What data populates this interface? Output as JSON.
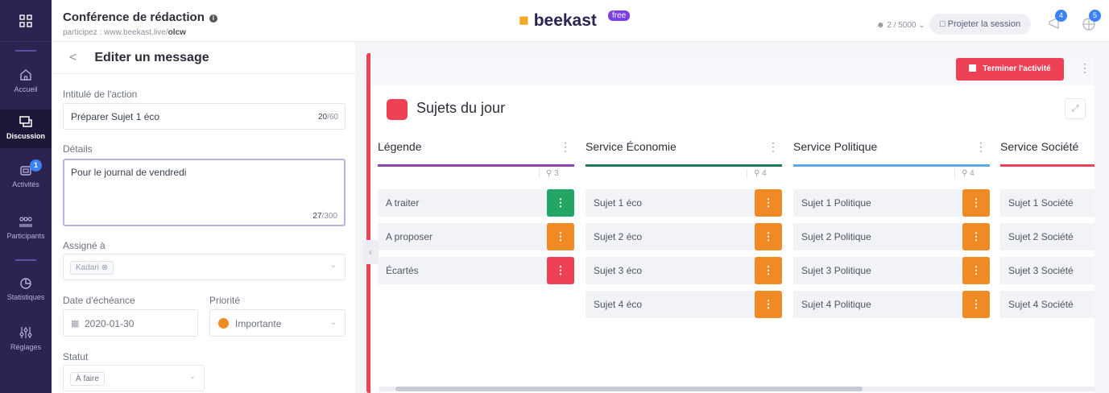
{
  "sidebar": {
    "items": [
      {
        "label": "Accueil",
        "icon": "home-icon"
      },
      {
        "label": "Discussion",
        "icon": "chat-icon",
        "active": true
      },
      {
        "label": "Activités",
        "icon": "activities-icon",
        "badge": "1"
      },
      {
        "label": "Participants",
        "icon": "participants-icon"
      },
      {
        "label": "Statistiques",
        "icon": "stats-icon"
      },
      {
        "label": "Réglages",
        "icon": "settings-icon"
      }
    ]
  },
  "header": {
    "title": "Conférence de rédaction",
    "info": "i",
    "subtitle_prefix": "participez : www.beekast.live/",
    "subtitle_code": "olcw",
    "brand": "beekast",
    "brand_badge": "free",
    "participants": "2 / 5000",
    "project_label": "Projeter la session",
    "notif_badge_1": "4",
    "notif_badge_2": "5"
  },
  "panel": {
    "back": "<",
    "title": "Editer un message",
    "action_label": "Intitulé de l'action",
    "action_value": "Préparer Sujet 1 éco",
    "action_count": "20",
    "action_max": "/60",
    "details_label": "Détails",
    "details_value": "Pour le journal de vendredi",
    "details_count": "27",
    "details_max": "/300",
    "assigned_label": "Assigné à",
    "assigned_value": "Kadari",
    "due_label": "Date d'échéance",
    "due_value": "2020-01-30",
    "priority_label": "Priorité",
    "priority_value": "Importante",
    "status_label": "Statut",
    "status_value": "À faire"
  },
  "board": {
    "end_label": "Terminer l'activité",
    "title": "Sujets du jour",
    "columns": [
      {
        "name": "Légende",
        "count": "3",
        "color": "#8e44ad",
        "cards": [
          {
            "label": "A traiter",
            "color": "#22a565"
          },
          {
            "label": "A proposer",
            "color": "#f08a24"
          },
          {
            "label": "Écartés",
            "color": "#ef4155"
          }
        ]
      },
      {
        "name": "Service Économie",
        "count": "4",
        "color": "#1f7a5c",
        "cards": [
          {
            "label": "Sujet 1 éco"
          },
          {
            "label": "Sujet 2 éco"
          },
          {
            "label": "Sujet 3 éco"
          },
          {
            "label": "Sujet 4 éco"
          }
        ]
      },
      {
        "name": "Service Politique",
        "count": "4",
        "color": "#5aa9e6",
        "cards": [
          {
            "label": "Sujet 1 Politique"
          },
          {
            "label": "Sujet 2 Politique"
          },
          {
            "label": "Sujet 3 Politique"
          },
          {
            "label": "Sujet 4 Politique"
          }
        ]
      },
      {
        "name": "Service Société",
        "color": "#ef4155",
        "cards": [
          {
            "label": "Sujet 1 Société"
          },
          {
            "label": "Sujet 2 Société"
          },
          {
            "label": "Sujet 3 Société"
          },
          {
            "label": "Sujet 4 Société"
          }
        ]
      }
    ]
  },
  "colors": {
    "accent": "#ef4155",
    "sidebar": "#2b2350",
    "orange": "#f08a24",
    "green": "#22a565"
  }
}
